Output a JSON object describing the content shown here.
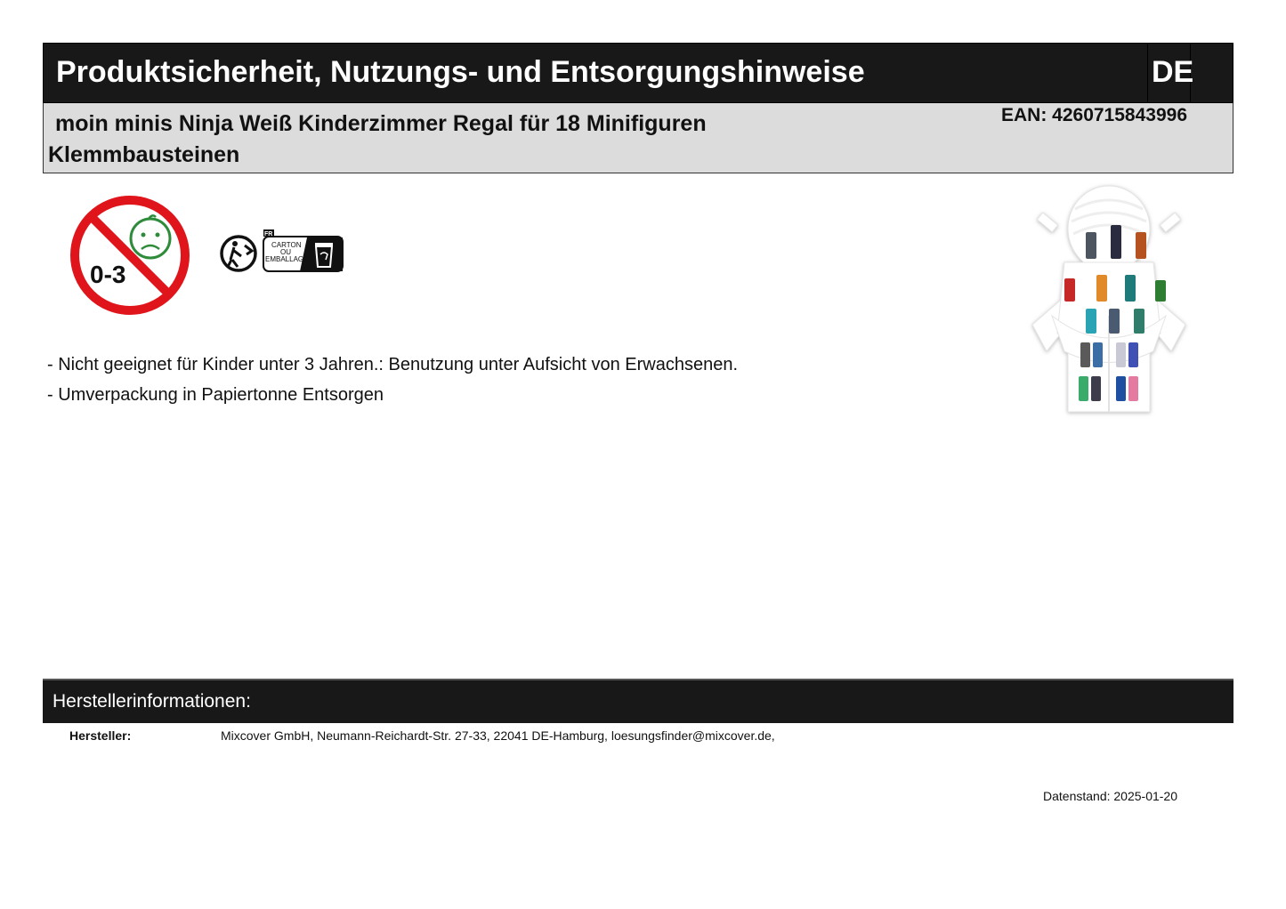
{
  "header": {
    "title": "Produktsicherheit, Nutzungs- und Entsorgungshinweise",
    "language": "DE"
  },
  "product": {
    "name": "moin minis Ninja Weiß Kinderzimmer Regal für 18 Minifiguren Klemmbausteinen",
    "ean": "EAN: 4260715843996"
  },
  "icons": {
    "age_warning": {
      "name": "not-suitable-under-3-icon",
      "label": "0-3",
      "color": "#e0151b",
      "face_color": "#2e8b3a"
    },
    "recycling": {
      "name": "triman-recycling-icon",
      "country": "FR",
      "lines": [
        "CARTON",
        "OU",
        "EMBALLAGE"
      ]
    },
    "product_image": {
      "name": "ninja-shelf-product-image"
    }
  },
  "notes": [
    "- Nicht geeignet für Kinder unter 3 Jahren.: Benutzung unter Aufsicht von Erwachsenen.",
    "- Umverpackung in Papiertonne Entsorgen"
  ],
  "manufacturer": {
    "section_title": "Herstellerinformationen:",
    "label": "Hersteller:",
    "value": "Mixcover GmbH, Neumann-Reichardt-Str. 27-33, 22041 DE-Hamburg, loesungsfinder@mixcover.de,"
  },
  "footer": {
    "datestand": "Datenstand: 2025-01-20"
  }
}
